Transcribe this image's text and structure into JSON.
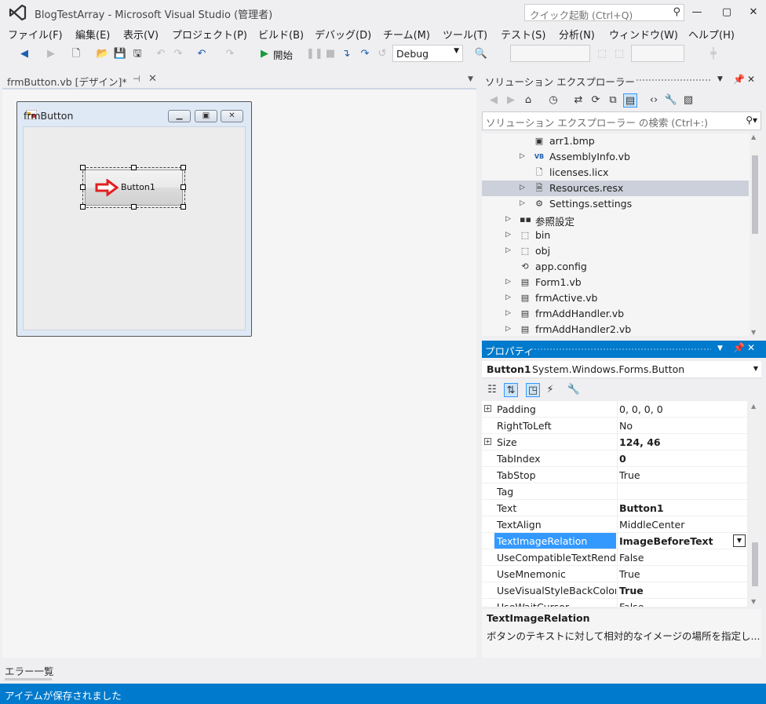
{
  "window": {
    "title": "BlogTestArray - Microsoft Visual Studio (管理者)",
    "quick_launch_placeholder": "クイック起動 (Ctrl+Q)"
  },
  "menu": [
    "ファイル(F)",
    "編集(E)",
    "表示(V)",
    "プロジェクト(P)",
    "ビルド(B)",
    "デバッグ(D)",
    "チーム(M)",
    "ツール(T)",
    "テスト(S)",
    "分析(N)",
    "ウィンドウ(W)",
    "ヘルプ(H)"
  ],
  "toolbar": {
    "start_label": "開始",
    "configuration": "Debug"
  },
  "document": {
    "tab_label": "frmButton.vb [デザイン]*",
    "form_title": "frmButton",
    "button_text": "Button1"
  },
  "solution_explorer": {
    "title": "ソリューション エクスプローラー",
    "search_placeholder": "ソリューション エクスプローラー の検索 (Ctrl+:)",
    "items": [
      {
        "label": "arr1.bmp",
        "icon": "image-file-icon",
        "arrow": false,
        "indent": 2
      },
      {
        "label": "AssemblyInfo.vb",
        "icon": "vb-file-icon",
        "arrow": true,
        "indent": 2
      },
      {
        "label": "licenses.licx",
        "icon": "file-icon",
        "arrow": false,
        "indent": 2
      },
      {
        "label": "Resources.resx",
        "icon": "resource-file-icon",
        "arrow": true,
        "indent": 2,
        "selected": true
      },
      {
        "label": "Settings.settings",
        "icon": "settings-gear-icon",
        "arrow": true,
        "indent": 2
      },
      {
        "label": "参照設定",
        "icon": "references-icon",
        "arrow": true,
        "indent": 1
      },
      {
        "label": "bin",
        "icon": "folder-dotted-icon",
        "arrow": true,
        "indent": 1
      },
      {
        "label": "obj",
        "icon": "folder-dotted-icon",
        "arrow": true,
        "indent": 1
      },
      {
        "label": "app.config",
        "icon": "config-file-icon",
        "arrow": false,
        "indent": 1
      },
      {
        "label": "Form1.vb",
        "icon": "form-file-icon",
        "arrow": true,
        "indent": 1
      },
      {
        "label": "frmActive.vb",
        "icon": "form-file-icon",
        "arrow": true,
        "indent": 1
      },
      {
        "label": "frmAddHandler.vb",
        "icon": "form-file-icon",
        "arrow": true,
        "indent": 1
      },
      {
        "label": "frmAddHandler2.vb",
        "icon": "form-file-icon",
        "arrow": true,
        "indent": 1
      }
    ]
  },
  "properties": {
    "title": "プロパティ",
    "object_name": "Button1",
    "object_type": "System.Windows.Forms.Button",
    "rows": [
      {
        "name": "Padding",
        "value": "0, 0, 0, 0",
        "expand": true,
        "bold": false
      },
      {
        "name": "RightToLeft",
        "value": "No",
        "expand": false,
        "bold": false
      },
      {
        "name": "Size",
        "value": "124, 46",
        "expand": true,
        "bold": true
      },
      {
        "name": "TabIndex",
        "value": "0",
        "expand": false,
        "bold": true
      },
      {
        "name": "TabStop",
        "value": "True",
        "expand": false,
        "bold": false
      },
      {
        "name": "Tag",
        "value": "",
        "expand": false,
        "bold": false
      },
      {
        "name": "Text",
        "value": "Button1",
        "expand": false,
        "bold": true
      },
      {
        "name": "TextAlign",
        "value": "MiddleCenter",
        "expand": false,
        "bold": false
      },
      {
        "name": "TextImageRelation",
        "value": "ImageBeforeText",
        "expand": false,
        "bold": true,
        "selected": true
      },
      {
        "name": "UseCompatibleTextRendering",
        "value": "False",
        "expand": false,
        "bold": false
      },
      {
        "name": "UseMnemonic",
        "value": "True",
        "expand": false,
        "bold": false
      },
      {
        "name": "UseVisualStyleBackColor",
        "value": "True",
        "expand": false,
        "bold": true
      },
      {
        "name": "UseWaitCursor",
        "value": "False",
        "expand": false,
        "bold": false
      }
    ],
    "description_title": "TextImageRelation",
    "description_text": "ボタンのテキストに対して相対的なイメージの場所を指定し..."
  },
  "bottom": {
    "error_list_tab": "エラー一覧",
    "status": "アイテムが保存されました"
  },
  "colors": {
    "accent": "#007acc",
    "selection": "#3399ff",
    "arrow_red": "#e02020"
  }
}
